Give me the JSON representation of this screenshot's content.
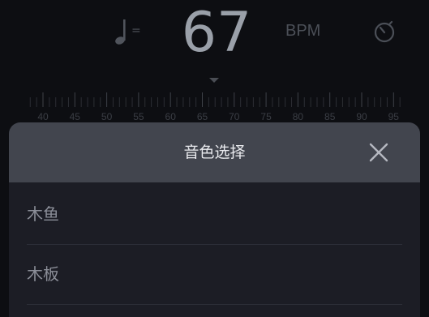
{
  "header": {
    "note_equals": "=",
    "bpm_value": "67",
    "bpm_unit": "BPM"
  },
  "ruler": {
    "labels": [
      "40",
      "45",
      "50",
      "55",
      "60",
      "65",
      "70",
      "75",
      "80",
      "85",
      "90",
      "95"
    ],
    "selected_value": 67
  },
  "sheet": {
    "title": "音色选择",
    "items": [
      {
        "label": "木鱼"
      },
      {
        "label": "木板"
      }
    ]
  },
  "colors": {
    "background": "#0d0e12",
    "sheet_header": "#42454e",
    "sheet_body": "#1c1d25",
    "bpm_text": "#9aa0a9"
  },
  "icons": [
    "quarter-note-icon",
    "timer-icon",
    "close-icon"
  ]
}
